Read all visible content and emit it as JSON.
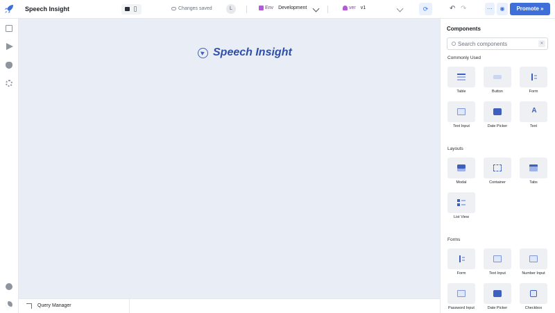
{
  "header": {
    "app_title": "Speech Insight",
    "save_status": "Changes saved",
    "avatar_initial": "L",
    "environment": {
      "label": "Env",
      "value": "Development"
    },
    "version": {
      "label": "ver",
      "value": "v1"
    },
    "promote_label": "Promote »"
  },
  "canvas": {
    "brand_text": "Speech Insight"
  },
  "bottom": {
    "query_manager_label": "Query Manager"
  },
  "components_panel": {
    "title": "Components",
    "search_placeholder": "Search components",
    "sections": {
      "commonly_used": {
        "title": "Commonly Used",
        "items": [
          "Table",
          "Button",
          "Form",
          "Text Input",
          "Date Picker",
          "Text"
        ]
      },
      "layouts": {
        "title": "Layouts",
        "items": [
          "Modal",
          "Container",
          "Tabs",
          "List View"
        ]
      },
      "forms": {
        "title": "Forms",
        "items": [
          "Form",
          "Text Input",
          "Number Input",
          "Password Input",
          "Date Picker",
          "Checkbox"
        ]
      }
    }
  },
  "colors": {
    "accent": "#3e6fd8",
    "canvas_bg": "#e9eef6",
    "brand": "#2f4fa8"
  },
  "icons": {
    "logo": "rocket-icon",
    "nav": [
      "pages-icon",
      "queries-icon",
      "debugger-icon",
      "settings-icon",
      "chat-icon",
      "theme-icon"
    ]
  }
}
